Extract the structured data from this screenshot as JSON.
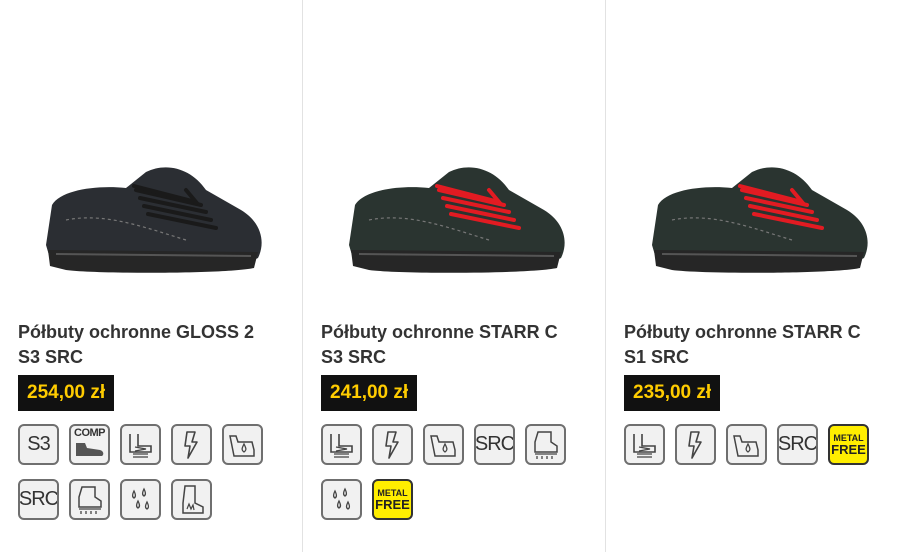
{
  "products": [
    {
      "title": "Półbuty ochronne GLOSS 2 S3 SRC",
      "price": "254,00 zł",
      "shoe_color": "#2b2e33",
      "lace_color": "#1a1a1a",
      "icons": [
        {
          "type": "text",
          "label": "S3",
          "name": "s3-icon"
        },
        {
          "type": "comp",
          "label": "COMP",
          "name": "comp-toecap-icon"
        },
        {
          "type": "svg",
          "name": "shock-absorption-icon"
        },
        {
          "type": "svg",
          "name": "antistatic-icon"
        },
        {
          "type": "svg",
          "name": "water-resistant-icon"
        },
        {
          "type": "text",
          "label": "SRC",
          "name": "src-slip-icon"
        },
        {
          "type": "svg",
          "name": "anti-puncture-icon"
        },
        {
          "type": "svg",
          "name": "oil-resistant-icon"
        },
        {
          "type": "svg",
          "name": "heat-resistant-sole-icon"
        }
      ]
    },
    {
      "title": "Półbuty ochronne STARR C S3 SRC",
      "price": "241,00 zł",
      "shoe_color": "#2a3430",
      "lace_color": "#e21b22",
      "icons": [
        {
          "type": "svg",
          "name": "shock-absorption-icon"
        },
        {
          "type": "svg",
          "name": "antistatic-icon"
        },
        {
          "type": "svg",
          "name": "water-resistant-icon"
        },
        {
          "type": "text",
          "label": "SRC",
          "name": "src-slip-icon"
        },
        {
          "type": "svg",
          "name": "anti-puncture-icon"
        },
        {
          "type": "svg",
          "name": "oil-resistant-icon"
        },
        {
          "type": "metal",
          "label1": "METAL",
          "label2": "FREE",
          "name": "metal-free-icon"
        }
      ]
    },
    {
      "title": "Półbuty ochronne STARR C S1 SRC",
      "price": "235,00 zł",
      "shoe_color": "#2a3430",
      "lace_color": "#e21b22",
      "icons": [
        {
          "type": "svg",
          "name": "shock-absorption-icon"
        },
        {
          "type": "svg",
          "name": "antistatic-icon"
        },
        {
          "type": "svg",
          "name": "water-resistant-icon"
        },
        {
          "type": "text",
          "label": "SRC",
          "name": "src-slip-icon"
        },
        {
          "type": "metal",
          "label1": "METAL",
          "label2": "FREE",
          "name": "metal-free-icon"
        }
      ]
    }
  ],
  "colors": {
    "price_bg": "#111111",
    "price_text": "#ffcc00",
    "title_text": "#333333"
  }
}
